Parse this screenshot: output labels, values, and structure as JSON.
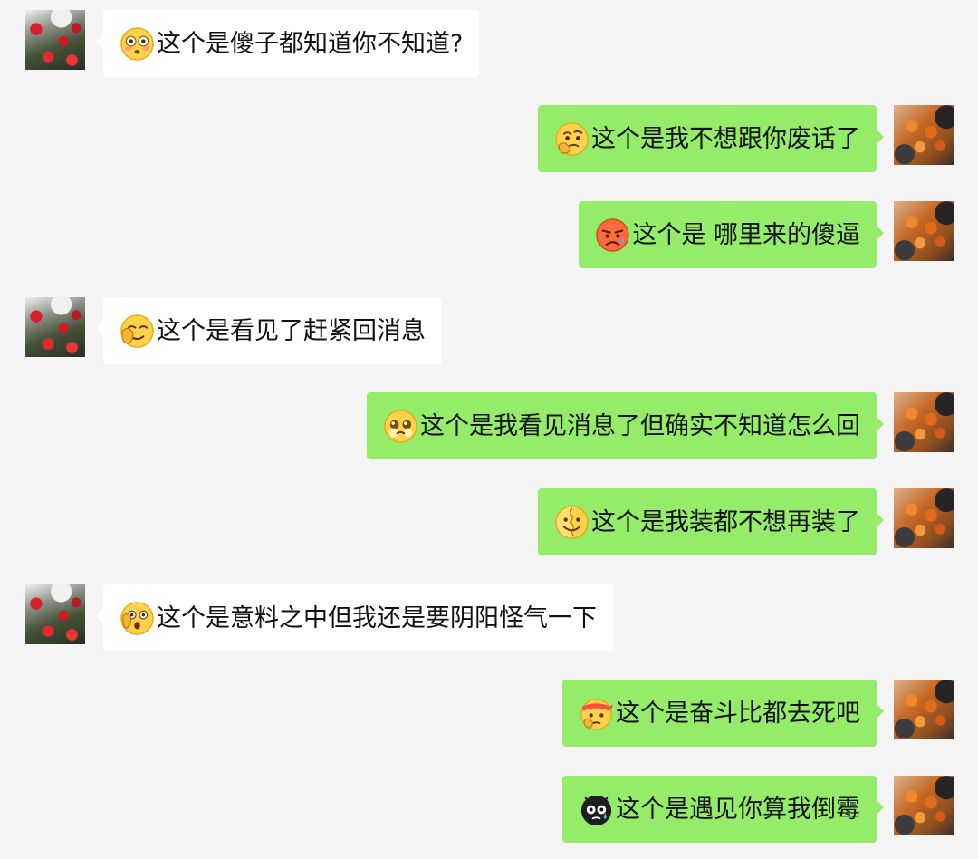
{
  "messages": [
    {
      "side": "left",
      "emoji": "flushed-face-icon",
      "text": "这个是傻子都知道你不知道?"
    },
    {
      "side": "right",
      "emoji": "thinking-face-icon",
      "text": "这个是我不想跟你废话了"
    },
    {
      "side": "right",
      "emoji": "frowning-sweat-face-icon",
      "text": "这个是 哪里来的傻逼"
    },
    {
      "side": "left",
      "emoji": "smirk-hand-face-icon",
      "text": "这个是看见了赶紧回消息"
    },
    {
      "side": "right",
      "emoji": "pleading-face-icon",
      "text": "这个是我看见消息了但确实不知道怎么回"
    },
    {
      "side": "right",
      "emoji": "split-smile-face-icon",
      "text": "这个是我装都不想再装了"
    },
    {
      "side": "left",
      "emoji": "surprised-hand-face-icon",
      "text": "这个是意料之中但我还是要阴阳怪气一下"
    },
    {
      "side": "right",
      "emoji": "headband-thinking-face-icon",
      "text": "这个是奋斗比都去死吧"
    },
    {
      "side": "right",
      "emoji": "black-sweat-face-icon",
      "text": "这个是遇见你算我倒霉"
    }
  ],
  "colors": {
    "background": "#f5f5f5",
    "left_bubble": "#ffffff",
    "right_bubble": "#95ec69",
    "text": "#111111"
  }
}
